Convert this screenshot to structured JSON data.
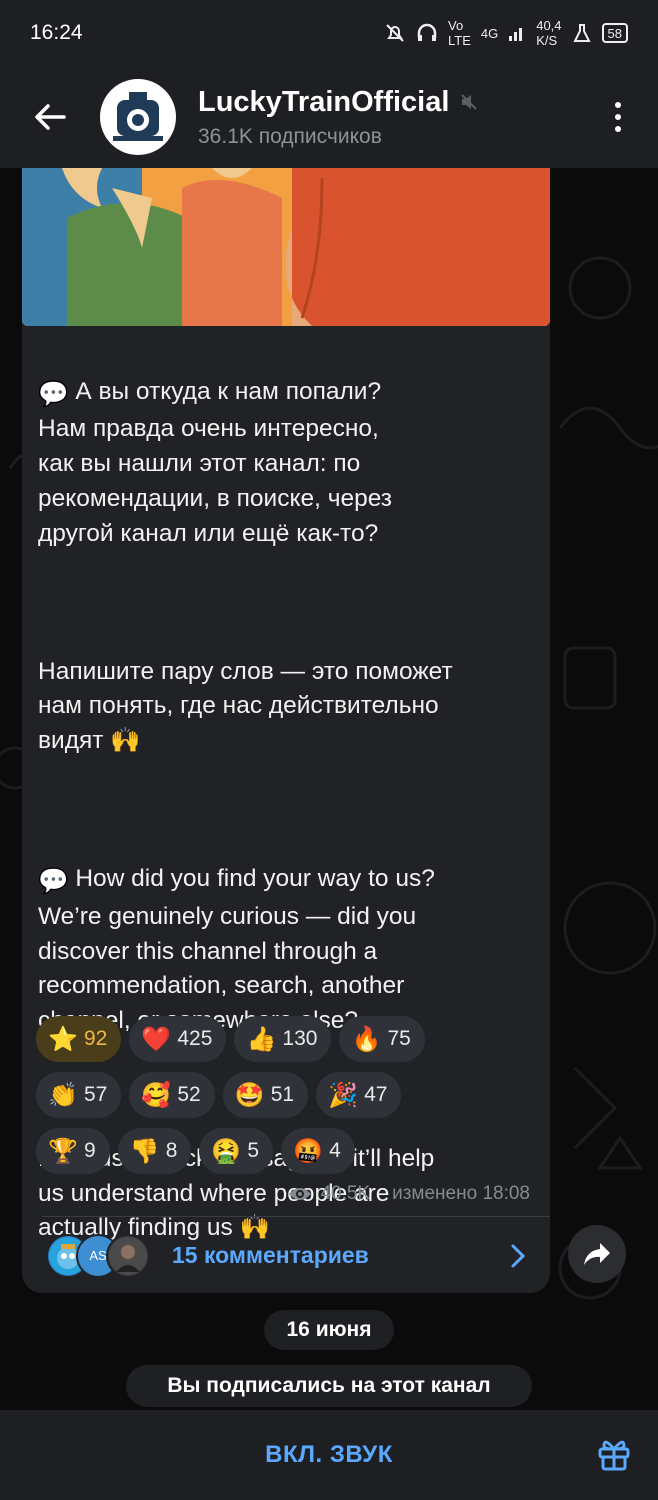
{
  "status_bar": {
    "time": "16:24",
    "network": "4G",
    "speed": "40,4",
    "speed_unit": "K/S",
    "battery": "58"
  },
  "header": {
    "title": "LuckyTrainOfficial",
    "subscribers": "36.1K подписчиков"
  },
  "message": {
    "paragraphs": [
      "А вы откуда к нам попали?\nНам правда очень интересно,\nкак вы нашли этот канал: по\nрекомендации, в поиске, через\nдругой канал или ещё как-то?",
      "Напишите пару слов — это поможет\nнам понять, где нас действительно\nвидят",
      "How did you find your way to us?\nWe’re genuinely curious — did you\ndiscover this channel through a\nrecommendation, search, another\nchannel, or somewhere else?",
      "Drop us a quick message — it’ll help\nus understand where people are\nactually finding us"
    ],
    "reactions": [
      {
        "icon": "star-icon",
        "glyph": "⭐",
        "count": "92"
      },
      {
        "icon": "heart-icon",
        "glyph": "❤️",
        "count": "425"
      },
      {
        "icon": "thumbs-up-icon",
        "glyph": "👍",
        "count": "130"
      },
      {
        "icon": "fire-icon",
        "glyph": "🔥",
        "count": "75"
      },
      {
        "icon": "clap-icon",
        "glyph": "👏",
        "count": "57"
      },
      {
        "icon": "smiling-hearts-icon",
        "glyph": "🥰",
        "count": "52"
      },
      {
        "icon": "star-struck-icon",
        "glyph": "🤩",
        "count": "51"
      },
      {
        "icon": "party-popper-icon",
        "glyph": "🎉",
        "count": "47"
      },
      {
        "icon": "trophy-icon",
        "glyph": "🏆",
        "count": "9"
      },
      {
        "icon": "thumbs-down-icon",
        "glyph": "👎",
        "count": "8"
      },
      {
        "icon": "vomit-icon",
        "glyph": "🤮",
        "count": "5"
      },
      {
        "icon": "cursing-face-icon",
        "glyph": "🤬",
        "count": "4"
      }
    ],
    "views": "40.5K",
    "edited": "изменено 18:08",
    "comments": {
      "label": "15 комментариев",
      "avatar_initials": "AS"
    }
  },
  "date_separator": "16 июня",
  "service_message": "Вы подписались на этот канал",
  "bottom_bar": {
    "unmute_label": "ВКЛ. ЗВУК"
  },
  "colors": {
    "accent": "#5aa9ff",
    "bubble": "#212226",
    "header": "#1e1f22",
    "active_reaction": "#f0b84a"
  }
}
